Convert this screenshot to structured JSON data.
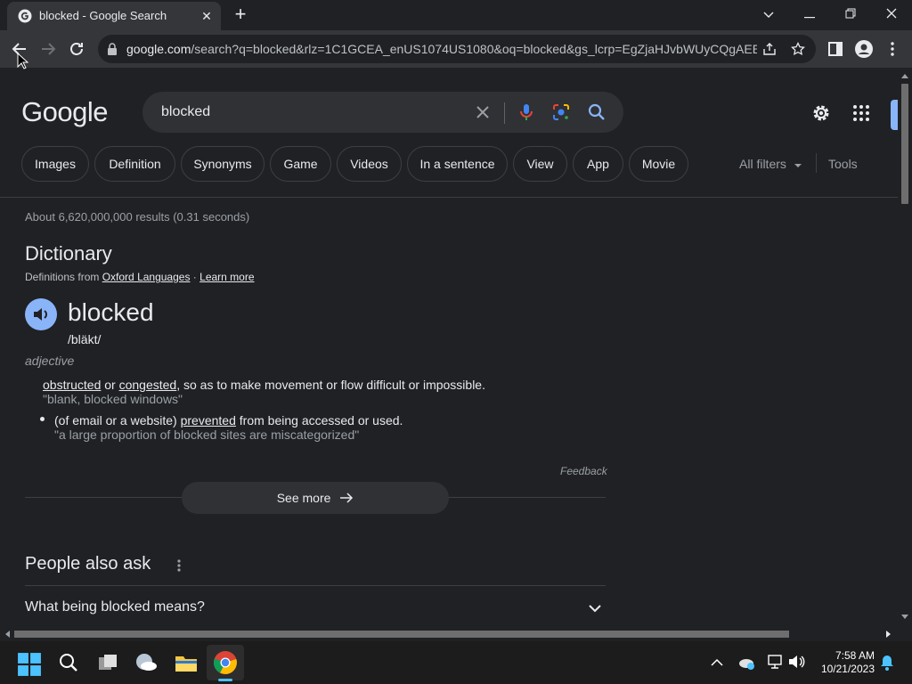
{
  "browser": {
    "tab_title": "blocked - Google Search",
    "url_host": "google.com",
    "url_rest": "/search?q=blocked&rlz=1C1GCEA_enUS1074US1080&oq=blocked&gs_lcrp=EgZjaHJvbWUyCQgAEE..."
  },
  "search": {
    "logo": "Google",
    "query": "blocked",
    "chips": [
      "Images",
      "Definition",
      "Synonyms",
      "Game",
      "Videos",
      "In a sentence",
      "View",
      "App",
      "Movie"
    ],
    "all_filters": "All filters",
    "tools": "Tools",
    "stats": "About 6,620,000,000 results (0.31 seconds)"
  },
  "dictionary": {
    "title": "Dictionary",
    "from_prefix": "Definitions from",
    "source": "Oxford Languages",
    "dot": " · ",
    "learn_more": "Learn more",
    "word": "blocked",
    "phonetic": "/bläkt/",
    "part_of_speech": "adjective",
    "def1_w1": "obstructed",
    "def1_or": " or ",
    "def1_w2": "congested",
    "def1_rest": ", so as to make movement or flow difficult or impossible.",
    "ex1": "\"blank, blocked windows\"",
    "def2_pre": "(of email or a website) ",
    "def2_w": "prevented",
    "def2_rest": " from being accessed or used.",
    "ex2": "\"a large proportion of blocked sites are miscategorized\"",
    "feedback": "Feedback",
    "see_more": "See more"
  },
  "paa": {
    "title": "People also ask",
    "q1": "What being blocked means?"
  },
  "taskbar": {
    "time": "7:58 AM",
    "date": "10/21/2023"
  },
  "colors": {
    "page_bg": "#202124",
    "accent": "#8ab4f8",
    "chip_border": "#3c4043"
  }
}
